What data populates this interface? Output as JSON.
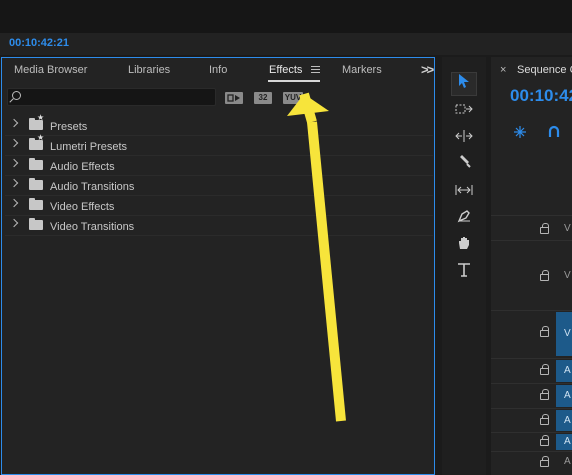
{
  "program_monitor": {
    "timecode": "00:10:42:21"
  },
  "effects_panel": {
    "tabs": [
      {
        "label": "Media Browser"
      },
      {
        "label": "Libraries"
      },
      {
        "label": "Info"
      },
      {
        "label": "Effects"
      },
      {
        "label": "Markers"
      }
    ],
    "active_tab": "Effects",
    "search": {
      "placeholder": ""
    },
    "filter_buttons": [
      {
        "label": "",
        "icon": "accelerated-effects-icon"
      },
      {
        "label": "32",
        "icon": "32-bit-color-icon"
      },
      {
        "label": "YUV",
        "icon": "yuv-effects-icon"
      }
    ],
    "tree": [
      {
        "label": "Presets",
        "icon": "preset-folder-icon"
      },
      {
        "label": "Lumetri Presets",
        "icon": "preset-folder-icon"
      },
      {
        "label": "Audio Effects",
        "icon": "folder-icon"
      },
      {
        "label": "Audio Transitions",
        "icon": "folder-icon"
      },
      {
        "label": "Video Effects",
        "icon": "folder-icon"
      },
      {
        "label": "Video Transitions",
        "icon": "folder-icon"
      }
    ]
  },
  "tools": [
    "selection-tool-icon",
    "track-select-tool-icon",
    "ripple-edit-tool-icon",
    "razor-tool-icon",
    "slip-tool-icon",
    "pen-tool-icon",
    "hand-tool-icon",
    "type-tool-icon"
  ],
  "sequence_panel": {
    "close": "×",
    "title": "Sequence C",
    "timecode": "00:10:42",
    "tracks": [
      {
        "tag": "V",
        "highlighted": false
      },
      {
        "tag": "V",
        "highlighted": false
      },
      {
        "tag": "V",
        "highlighted": true
      },
      {
        "tag": "A",
        "highlighted": true
      },
      {
        "tag": "A",
        "highlighted": true
      },
      {
        "tag": "A",
        "highlighted": true
      },
      {
        "tag": "A",
        "highlighted": true
      },
      {
        "tag": "A",
        "highlighted": false
      }
    ]
  },
  "colors": {
    "accent": "#2d8ceb",
    "annotation": "#f7e43b"
  }
}
